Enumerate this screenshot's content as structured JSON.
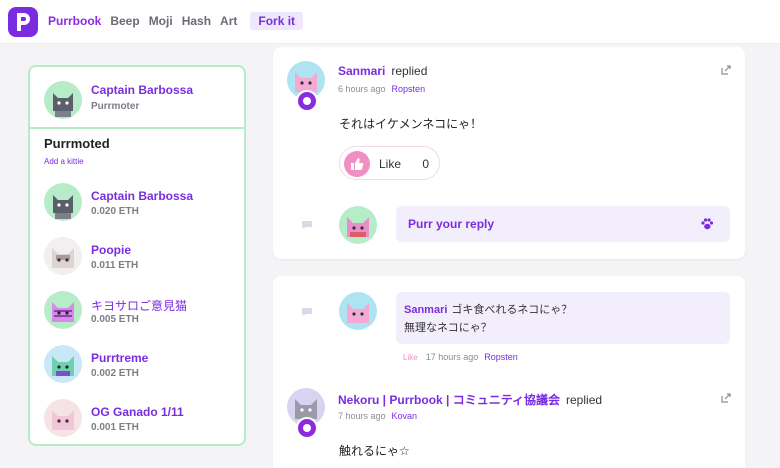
{
  "nav": {
    "logo_letter": "p",
    "items": [
      "Purrbook",
      "Beep",
      "Moji",
      "Hash",
      "Art"
    ],
    "active_index": 0,
    "fork_label": "Fork it"
  },
  "sidebar": {
    "owner": {
      "name": "Captain Barbossa",
      "role": "Purrmoter"
    },
    "section_title": "Purrmoted",
    "add_link": "Add a kittie",
    "kitties": [
      {
        "name": "Captain Barbossa",
        "price": "0.020 ETH"
      },
      {
        "name": "Poopie",
        "price": "0.011 ETH"
      },
      {
        "name": "キヨサロご意見猫",
        "price": "0.005 ETH"
      },
      {
        "name": "Purrtreme",
        "price": "0.002 ETH"
      },
      {
        "name": "OG Ganado 1/11",
        "price": "0.001 ETH"
      }
    ]
  },
  "feed": {
    "post1": {
      "author": "Sanmari",
      "action": "replied",
      "time": "6 hours ago",
      "place": "Ropsten",
      "message": "それはイケメンネコにゃ！",
      "like_label": "Like",
      "like_count": "0",
      "reply_placeholder": "Purr your reply"
    },
    "post2": {
      "comment_author": "Sanmari",
      "comment_line1": "ゴキ食べれるネコにゃ？",
      "comment_line2": "無理なネコにゃ？",
      "comment_like": "Like",
      "comment_time": "17 hours ago",
      "comment_place": "Ropsten",
      "author": "Nekoru | Purrbook | コミュニティ協議会",
      "action": "replied",
      "time": "7 hours ago",
      "place": "Kovan",
      "message": "触れるにゃ☆"
    }
  },
  "colors": {
    "accent": "#7a2de0",
    "sidebar_border": "#b6ecc7",
    "like_pink": "#f08fc4"
  }
}
